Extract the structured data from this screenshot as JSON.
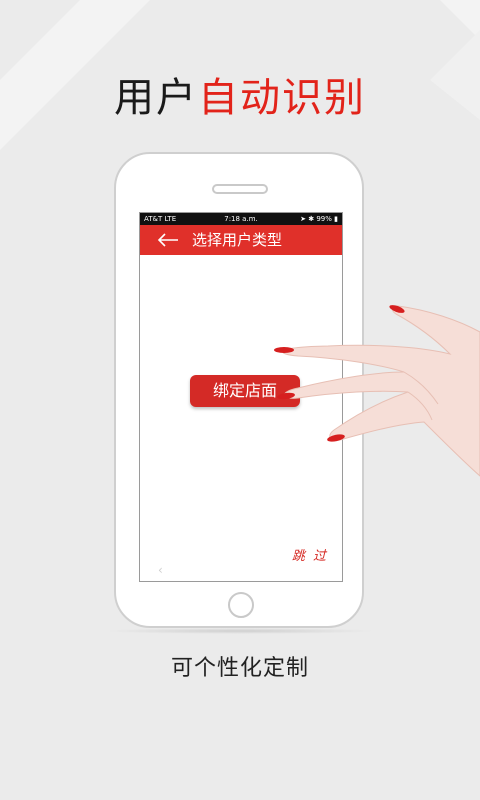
{
  "headline": {
    "part_dark": "用户",
    "part_red": "自动识别"
  },
  "phone": {
    "statusbar": {
      "carrier": "AT&T  LTE",
      "time": "7:18 a.m.",
      "right": "➤ ✱ 99% ▮"
    },
    "title": "选择用户类型",
    "bind_button": "绑定店面",
    "skip": "跳 过"
  },
  "caption": "可个性化定制",
  "colors": {
    "accent": "#e2231a",
    "titlebar": "#e0302a",
    "background": "#ebebeb"
  }
}
